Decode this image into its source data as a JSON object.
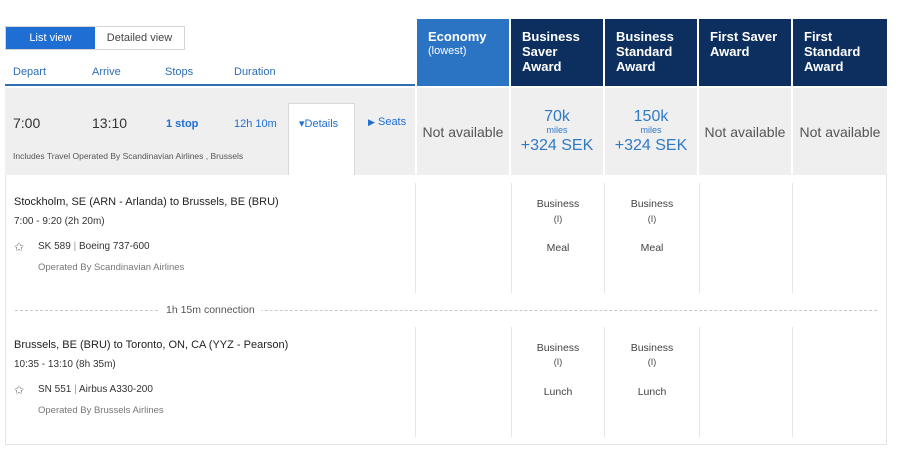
{
  "view_toggle": {
    "list": "List view",
    "detailed": "Detailed view"
  },
  "columns": {
    "depart": "Depart",
    "arrive": "Arrive",
    "stops": "Stops",
    "duration": "Duration"
  },
  "fare_headers": [
    {
      "title": "Economy",
      "sub": "(lowest)"
    },
    {
      "title": "Business Saver Award"
    },
    {
      "title": "Business Standard Award"
    },
    {
      "title": "First Saver Award"
    },
    {
      "title": "First Standard Award"
    }
  ],
  "summary": {
    "depart": "7:00",
    "arrive": "13:10",
    "stops": "1 stop",
    "duration": "12h 10m",
    "details_label": "Details",
    "seats_label": "Seats",
    "operated_note": "Includes Travel Operated By Scandinavian Airlines , Brussels"
  },
  "fares": {
    "economy": "Not available",
    "business_saver": {
      "miles": "70k",
      "unit": "miles",
      "price": "+324 SEK"
    },
    "business_standard": {
      "miles": "150k",
      "unit": "miles",
      "price": "+324 SEK"
    },
    "first_saver": "Not available",
    "first_standard": "Not available"
  },
  "segments": [
    {
      "route": "Stockholm, SE (ARN - Arlanda) to Brussels, BE (BRU)",
      "times": "7:00 - 9:20 (2h 20m)",
      "flight": "SK 589",
      "aircraft": "Boeing 737-600",
      "operated": "Operated By Scandinavian Airlines",
      "saver_cabin": "Business",
      "saver_class": "(I)",
      "saver_meal": "Meal",
      "standard_cabin": "Business",
      "standard_class": "(I)",
      "standard_meal": "Meal"
    },
    {
      "route": "Brussels, BE (BRU) to Toronto, ON, CA (YYZ - Pearson)",
      "times": "10:35 - 13:10 (8h 35m)",
      "flight": "SN 551",
      "aircraft": "Airbus A330-200",
      "operated": "Operated By Brussels Airlines",
      "saver_cabin": "Business",
      "saver_class": "(I)",
      "saver_meal": "Lunch",
      "standard_cabin": "Business",
      "standard_class": "(I)",
      "standard_meal": "Lunch"
    }
  ],
  "connection": "1h 15m connection",
  "separator": "|"
}
